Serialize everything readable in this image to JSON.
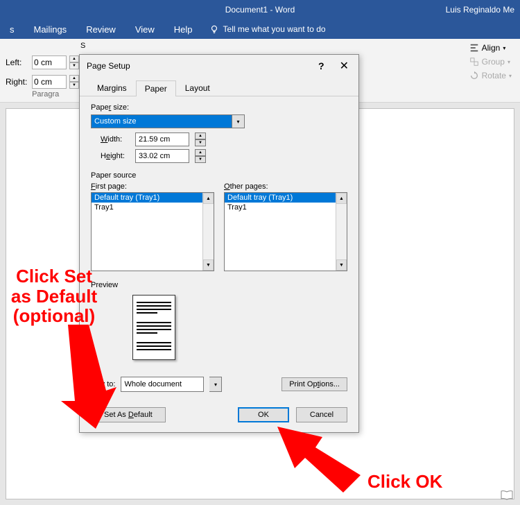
{
  "title": {
    "doc": "Document1  -  Word",
    "user": "Luis Reginaldo Me"
  },
  "ribbon": {
    "tabs": [
      "s",
      "Mailings",
      "Review",
      "View",
      "Help"
    ],
    "tell_me": "Tell me what you want to do",
    "left_label": "Left:",
    "right_label": "Right:",
    "left_val": "0 cm",
    "right_val": "0 cm",
    "group": "Paragra",
    "align": "Align",
    "group_btn": "Group",
    "rotate": "Rotate"
  },
  "dialog": {
    "title": "Page Setup",
    "tabs": {
      "margins": "Margins",
      "paper": "Paper",
      "layout": "Layout"
    },
    "paper_size_label": "Paper size:",
    "paper_size_value": "Custom size",
    "width_label": "Width:",
    "width_value": "21.59 cm",
    "height_label": "Height:",
    "height_value": "33.02 cm",
    "paper_source_label": "Paper source",
    "first_page_label": "First page:",
    "other_pages_label": "Other pages:",
    "tray_default": "Default tray (Tray1)",
    "tray1": "Tray1",
    "preview_label": "Preview",
    "apply_to_label": "pply to:",
    "apply_to_value": "Whole document",
    "print_options": "Print Options...",
    "set_default": "Set As Default",
    "ok": "OK",
    "cancel": "Cancel"
  },
  "annotations": {
    "a1": "Click Set as Default (optional)",
    "a2": "Click OK"
  }
}
